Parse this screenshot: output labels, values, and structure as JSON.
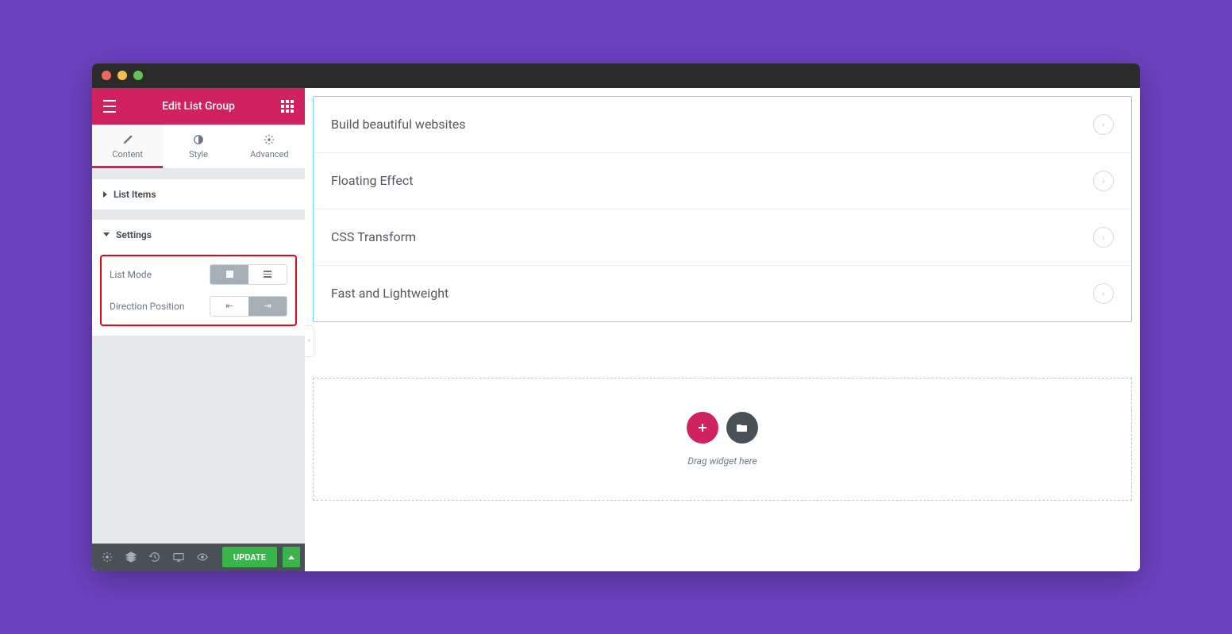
{
  "header": {
    "title": "Edit List Group"
  },
  "tabs": {
    "content": "Content",
    "style": "Style",
    "advanced": "Advanced"
  },
  "sections": {
    "listItems": "List Items",
    "settings": "Settings"
  },
  "controls": {
    "listMode": "List Mode",
    "directionPosition": "Direction Position"
  },
  "footer": {
    "update": "UPDATE"
  },
  "list": {
    "items": [
      "Build beautiful websites",
      "Floating Effect",
      "CSS Transform",
      "Fast and Lightweight"
    ]
  },
  "dropzone": {
    "text": "Drag widget here"
  }
}
